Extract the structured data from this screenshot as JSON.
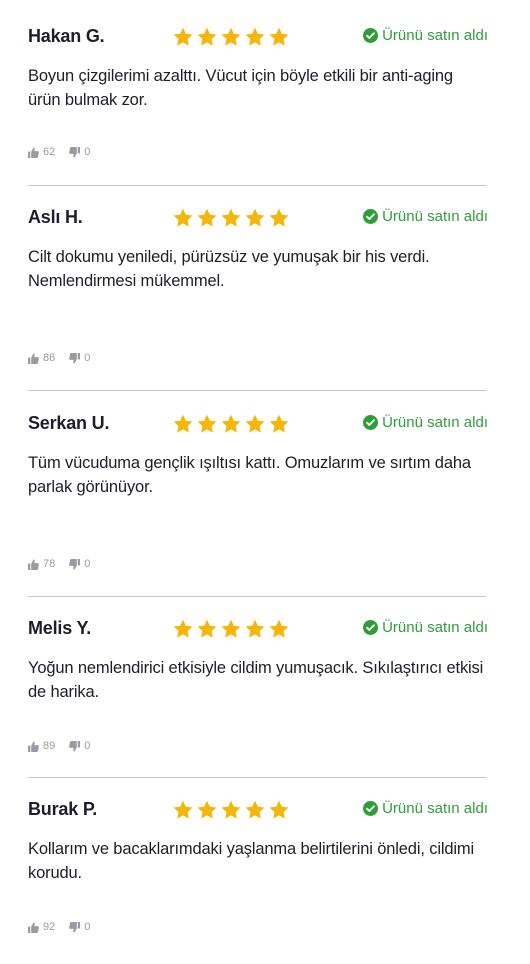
{
  "reviews": [
    {
      "name": "Hakan G.",
      "verified": "Ürünü satın aldı",
      "text": "Boyun çizgilerimi azalttı. Vücut için böyle etkili bir anti-aging ürün bulmak zor.",
      "likes": "62",
      "dislikes": "0",
      "rating": 5
    },
    {
      "name": "Aslı H.",
      "verified": "Ürünü satın aldı",
      "text": "Cilt dokumu yeniledi, pürüzsüz ve yumuşak bir his verdi. Nemlendirmesi mükemmel.",
      "likes": "86",
      "dislikes": "0",
      "rating": 5
    },
    {
      "name": "Serkan U.",
      "verified": "Ürünü satın aldı",
      "text": "Tüm vücuduma gençlik ışıltısı kattı. Omuzlarım ve sırtım daha parlak görünüyor.",
      "likes": "78",
      "dislikes": "0",
      "rating": 5
    },
    {
      "name": "Melis Y.",
      "verified": "Ürünü satın aldı",
      "text": "Yoğun nemlendirici etkisiyle cildim yumuşacık. Sıkılaştırıcı etkisi de harika.",
      "likes": "89",
      "dislikes": "0",
      "rating": 5
    },
    {
      "name": "Burak P.",
      "verified": "Ürünü satın aldı",
      "text": "Kollarım ve bacaklarımdaki yaşlanma belirtilerini önledi, cildimi korudu.",
      "likes": "92",
      "dislikes": "0",
      "rating": 5
    }
  ],
  "colors": {
    "star": "#f5b60a",
    "verified": "#2f9e3a",
    "text": "#1f1d2b",
    "muted": "#9a9aa2",
    "divider": "#c9c9cc"
  },
  "icons": {
    "star": "star-icon",
    "verified": "check-circle-icon",
    "like": "thumbs-up-icon",
    "dislike": "thumbs-down-icon"
  }
}
